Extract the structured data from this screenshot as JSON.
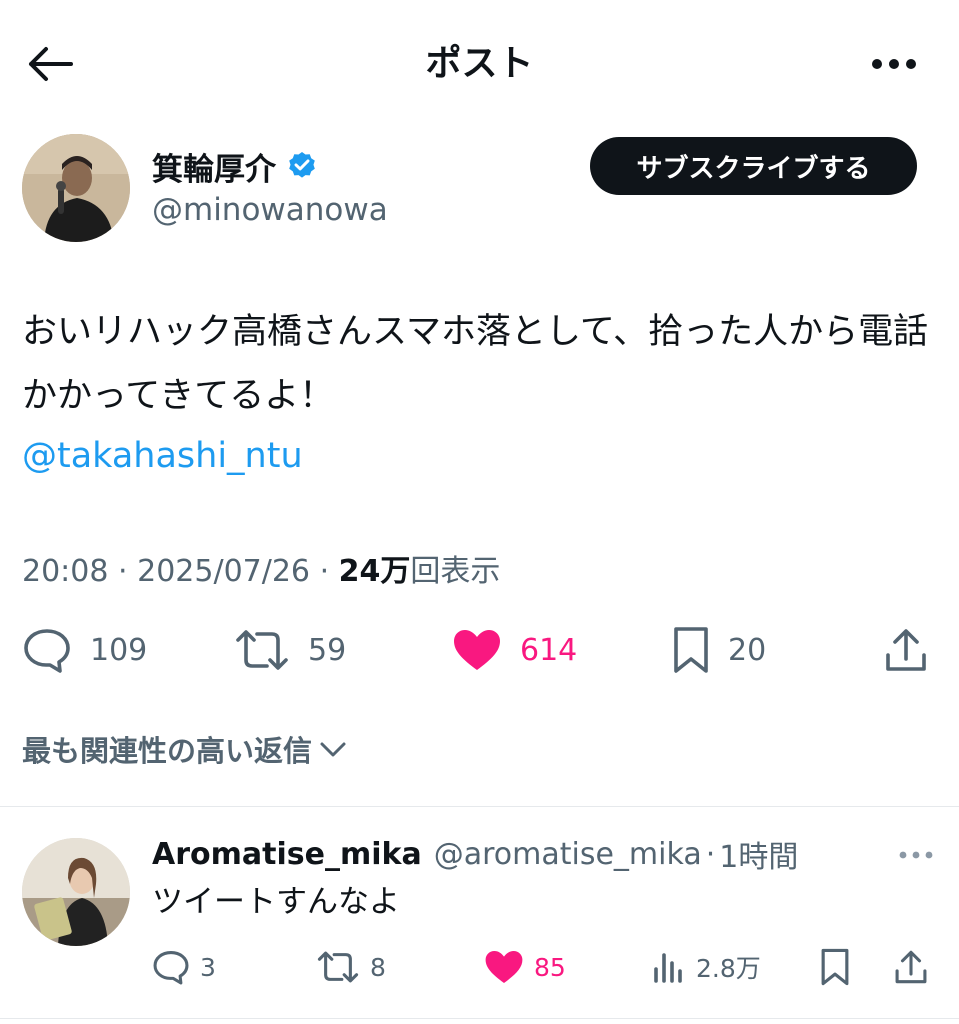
{
  "header": {
    "title": "ポスト"
  },
  "author": {
    "display_name": "箕輪厚介",
    "handle": "@minowanowa",
    "subscribe_label": "サブスクライブする",
    "verified": true
  },
  "tweet": {
    "text": "おいリハック高橋さんスマホ落として、拾った人から電話かかってきてるよ！",
    "mention": "@takahashi_ntu",
    "time": "20:08",
    "date": "2025/07/26",
    "separator": "·",
    "views_number": "24",
    "views_unit": "万",
    "views_label": "回表示"
  },
  "stats": {
    "replies": "109",
    "retweets": "59",
    "likes": "614",
    "bookmarks": "20"
  },
  "replies_section": {
    "sort_label": "最も関連性の高い返信"
  },
  "reply": {
    "display_name": "Aromatise_mika",
    "handle": "@aromatise_mika",
    "separator": "·",
    "time": "1時間",
    "text": "ツイートすんなよ",
    "stats": {
      "replies": "3",
      "retweets": "8",
      "likes": "85",
      "views": "2.8万"
    }
  },
  "colors": {
    "text_primary": "#0f1419",
    "text_secondary": "#536471",
    "link": "#1d9bf0",
    "like": "#f91880",
    "verified": "#1d9bf0",
    "button_bg": "#0f1419"
  },
  "icons": {
    "back": "arrow-left-icon",
    "more": "more-horizontal-icon",
    "verified": "verified-badge-icon",
    "reply": "comment-icon",
    "retweet": "retweet-icon",
    "like": "heart-icon",
    "bookmark": "bookmark-icon",
    "share": "share-icon",
    "views": "views-icon",
    "chevron": "chevron-down-icon"
  }
}
